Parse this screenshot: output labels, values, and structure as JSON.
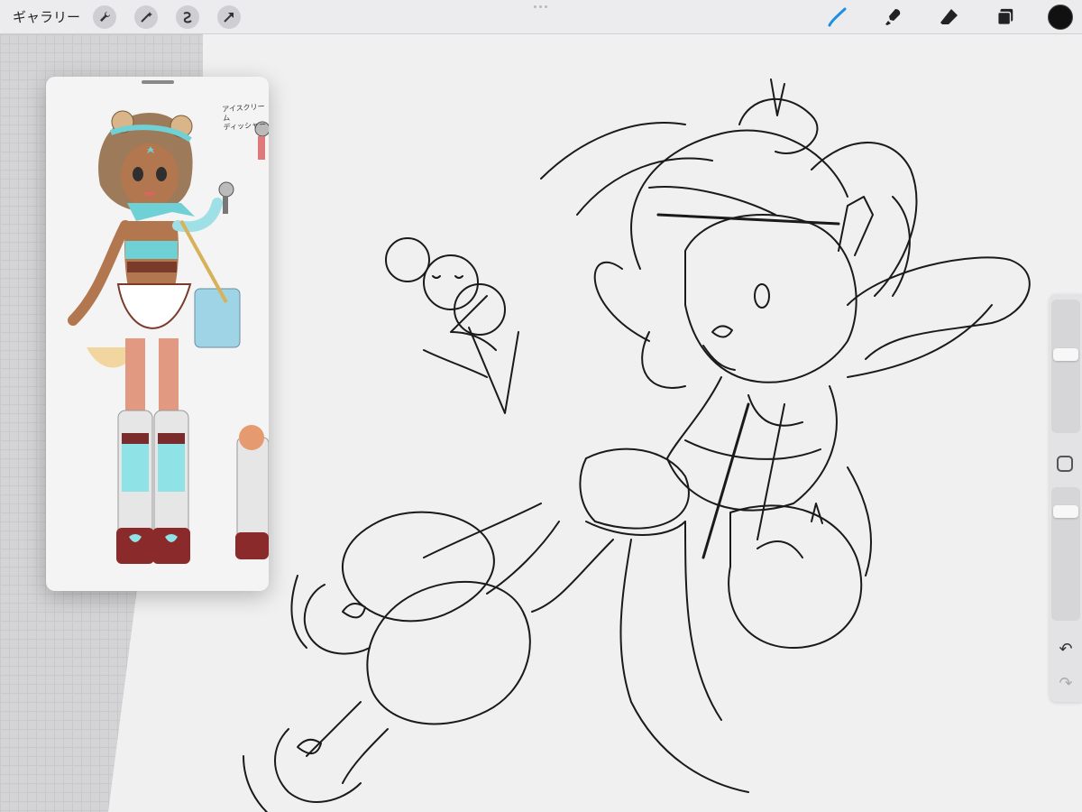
{
  "topbar": {
    "gallery_label": "ギャラリー",
    "left_tools": [
      "wrench-icon",
      "magic-wand-icon",
      "selection-icon",
      "transform-arrow-icon"
    ],
    "right_tools": [
      "brush-icon",
      "smudge-icon",
      "eraser-icon",
      "layers-icon"
    ],
    "active_tool": "brush-icon",
    "current_color": "#111111",
    "accent_color": "#1f8fe6"
  },
  "reference": {
    "note_line1": "アイスクリーム",
    "note_line2": "ディッシャー"
  },
  "sidebar": {
    "brush_size": 0.6,
    "brush_opacity": 0.85,
    "undo_icon": "undo-icon",
    "redo_icon": "redo-icon"
  }
}
